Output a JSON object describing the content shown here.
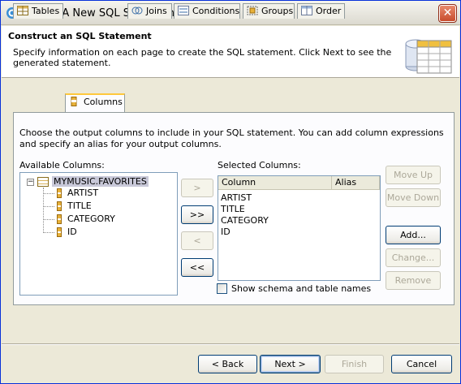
{
  "window": {
    "title": "Create A New SQL Statement",
    "close_label": "✕"
  },
  "header": {
    "title": "Construct an SQL Statement",
    "description": "Specify information on each page to create the SQL statement. Click Next to see the generated statement."
  },
  "tabs": [
    {
      "label": "Tables",
      "icon": "table-icon"
    },
    {
      "label": "Columns",
      "icon": "columns-icon"
    },
    {
      "label": "Joins",
      "icon": "joins-icon"
    },
    {
      "label": "Conditions",
      "icon": "conditions-icon"
    },
    {
      "label": "Groups",
      "icon": "groups-icon"
    },
    {
      "label": "Order",
      "icon": "order-icon"
    }
  ],
  "active_tab": "Columns",
  "columns_page": {
    "instructions": "Choose the output columns to include in your SQL statement. You can add column expressions and specify an alias for your output columns.",
    "available_label": "Available Columns:",
    "selected_label": "Selected Columns:",
    "table_name": "MYMUSIC.FAVORITES",
    "available_columns": [
      "ARTIST",
      "TITLE",
      "CATEGORY",
      "ID"
    ],
    "selected_header_column": "Column",
    "selected_header_alias": "Alias",
    "selected_columns": [
      "ARTIST",
      "TITLE",
      "CATEGORY",
      "ID"
    ],
    "move_buttons": {
      "add_one": ">",
      "add_all": ">>",
      "remove_one": "<",
      "remove_all": "<<"
    },
    "side_buttons": {
      "move_up": "Move Up",
      "move_down": "Move Down",
      "add": "Add...",
      "change": "Change...",
      "remove": "Remove"
    },
    "show_schema_label": "Show schema and table names",
    "show_schema_checked": false
  },
  "footer": {
    "back": "< Back",
    "next": "Next >",
    "finish": "Finish",
    "cancel": "Cancel"
  }
}
